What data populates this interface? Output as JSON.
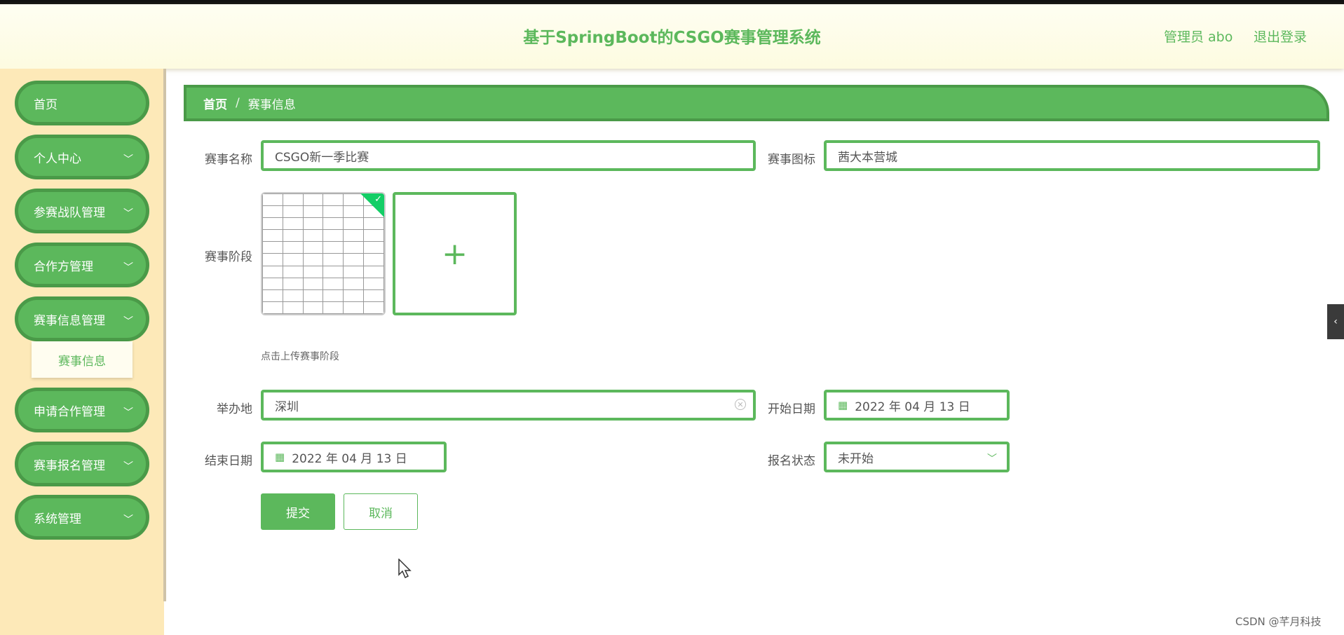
{
  "header": {
    "title": "基于SpringBoot的CSGO赛事管理系统",
    "admin": "管理员 abo",
    "logout": "退出登录"
  },
  "sidebar": {
    "items": [
      {
        "label": "首页"
      },
      {
        "label": "个人中心"
      },
      {
        "label": "参赛战队管理"
      },
      {
        "label": "合作方管理"
      },
      {
        "label": "赛事信息管理"
      },
      {
        "label": "申请合作管理"
      },
      {
        "label": "赛事报名管理"
      },
      {
        "label": "系统管理"
      }
    ],
    "sub_item": "赛事信息"
  },
  "breadcrumb": {
    "home": "首页",
    "separator": "/",
    "current": "赛事信息"
  },
  "form": {
    "event_name_label": "赛事名称",
    "event_name_value": "CSGO新一季比赛",
    "event_icon_label": "赛事图标",
    "event_icon_value": "茜大本营城",
    "stage_label": "赛事阶段",
    "upload_hint": "点击上传赛事阶段",
    "venue_label": "举办地",
    "venue_value": "深圳",
    "start_date_label": "开始日期",
    "start_date_value": "2022 年 04 月 13 日",
    "end_date_label": "结束日期",
    "end_date_value": "2022 年 04 月 13 日",
    "signup_status_label": "报名状态",
    "signup_status_value": "未开始",
    "submit": "提交",
    "cancel": "取消"
  },
  "watermark": "CSDN @芊月科技",
  "colors": {
    "accent": "#5cb85c",
    "accent_dark": "#4a9a48",
    "sidebar_bg": "#fde9b8"
  }
}
